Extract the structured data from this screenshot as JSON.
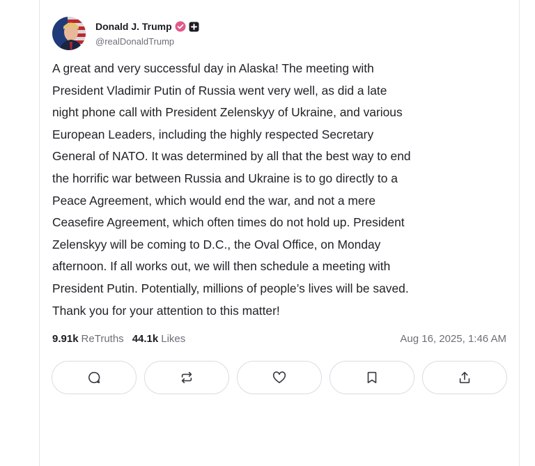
{
  "post": {
    "author": {
      "display_name": "Donald J. Trump",
      "handle": "@realDonaldTrump",
      "verified_icon": "verified-badge-icon",
      "badge_icon": "plus-square-icon"
    },
    "body": "A great and very successful day in Alaska! The meeting with\nPresident Vladimir Putin of Russia went very well, as did a late\nnight phone call with President Zelenskyy of Ukraine, and various\nEuropean Leaders, including the highly respected Secretary\nGeneral of NATO. It was determined by all that the best way to end\nthe horrific war between Russia and Ukraine is to go directly to a\nPeace Agreement, which would end the war, and not a mere\nCeasefire Agreement, which often times do not hold up. President\nZelenskyy will be coming to D.C., the Oval Office, on Monday\nafternoon. If all works out, we will then schedule a meeting with\nPresident Putin. Potentially, millions of people’s lives will be saved.\nThank you for your attention to this matter!",
    "stats": {
      "retruths_count": "9.91k",
      "retruths_label": "ReTruths",
      "likes_count": "44.1k",
      "likes_label": "Likes"
    },
    "timestamp": "Aug 16, 2025, 1:46 AM",
    "actions": [
      {
        "name": "reply",
        "icon": "comment-icon"
      },
      {
        "name": "retruth",
        "icon": "repost-icon"
      },
      {
        "name": "like",
        "icon": "heart-icon"
      },
      {
        "name": "bookmark",
        "icon": "bookmark-icon"
      },
      {
        "name": "share",
        "icon": "share-icon"
      }
    ]
  },
  "colors": {
    "verified_badge": "#e05a8a",
    "text_primary": "#1c1c24",
    "text_secondary": "#6e6e7a",
    "border": "#dcdce2"
  }
}
